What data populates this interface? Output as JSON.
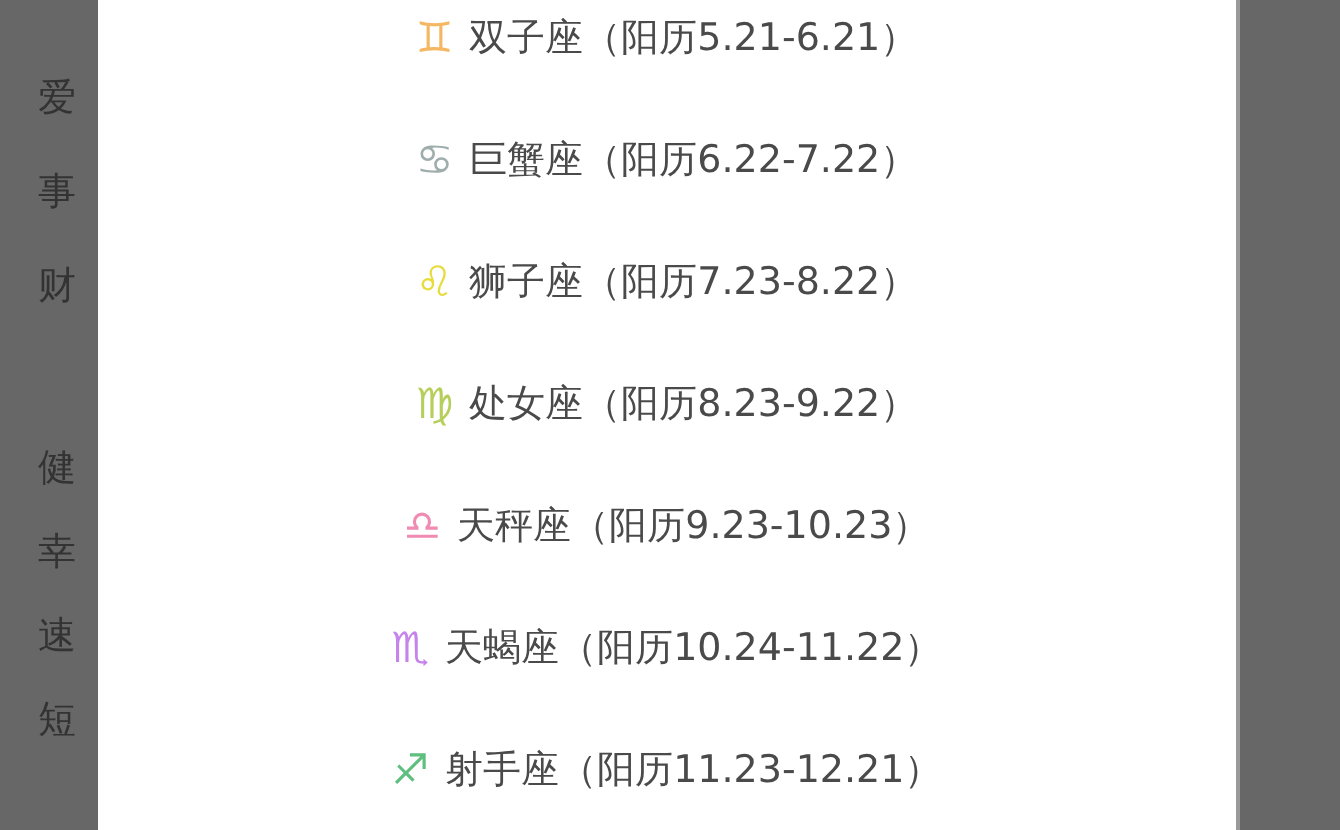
{
  "background": {
    "groups": [
      {
        "items": [
          "爱",
          "事",
          "财"
        ]
      },
      {
        "items": [
          "健",
          "幸",
          "速",
          "短"
        ]
      }
    ]
  },
  "dialog": {
    "signs": [
      {
        "symbol": "♊",
        "color": "#f5b763",
        "label": "双子座（阳历5.21-6.21）"
      },
      {
        "symbol": "♋",
        "color": "#9fadad",
        "label": "巨蟹座（阳历6.22-7.22）"
      },
      {
        "symbol": "♌",
        "color": "#e6dc3c",
        "label": "狮子座（阳历7.23-8.22）"
      },
      {
        "symbol": "♍",
        "color": "#b5cf5a",
        "label": "处女座（阳历8.23-9.22）"
      },
      {
        "symbol": "♎",
        "color": "#f08cb4",
        "label": "天秤座（阳历9.23-10.23）"
      },
      {
        "symbol": "♏",
        "color": "#c584ec",
        "label": "天蝎座（阳历10.24-11.22）"
      },
      {
        "symbol": "♐",
        "color": "#5fbf7f",
        "label": "射手座（阳历11.23-12.21）"
      }
    ]
  }
}
